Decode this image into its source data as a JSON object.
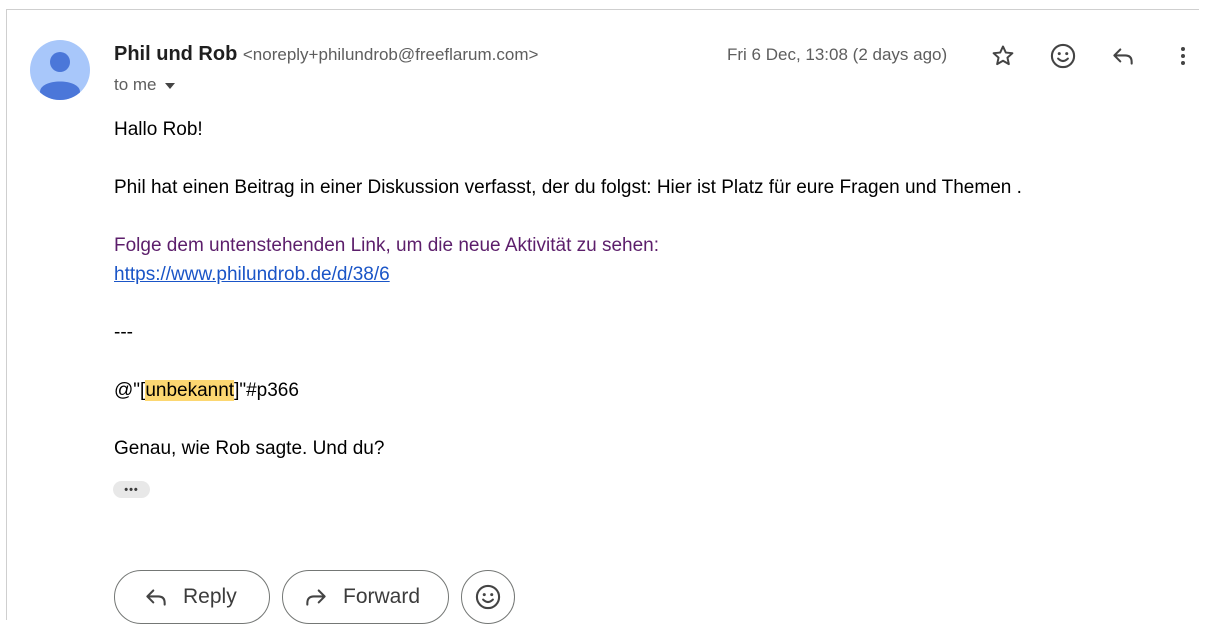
{
  "sender": {
    "name": "Phil und Rob",
    "email": "<noreply+philundrob@freeflarum.com>",
    "recipient_label": "to me"
  },
  "date": "Fri 6 Dec, 13:08 (2 days ago)",
  "header_icons": [
    "star-icon",
    "emoji-icon",
    "reply-icon",
    "more-vert-icon"
  ],
  "body": {
    "greeting": "Hallo Rob!",
    "line1": "Phil hat einen Beitrag in einer Diskussion verfasst, der du folgst: Hier ist Platz für eure Fragen und Themen .",
    "follow_text": "Folge dem untenstehenden Link, um die neue Aktivität zu sehen:",
    "link": "https://www.philundrob.de/d/38/6",
    "separator": "---",
    "mention_prefix": "@\"[",
    "mention_highlight": "unbekannt",
    "mention_suffix": "]\"#p366",
    "closing": "Genau, wie Rob sagte. Und du?"
  },
  "collapsed_indicator": "•••",
  "actions": {
    "reply_label": "Reply",
    "forward_label": "Forward"
  },
  "colors": {
    "avatar_bg": "#a8c7fa",
    "avatar_fg": "#4b77d9",
    "link": "#1a55c7",
    "purple_text": "#5c1e6b",
    "highlight": "#fcd771"
  }
}
